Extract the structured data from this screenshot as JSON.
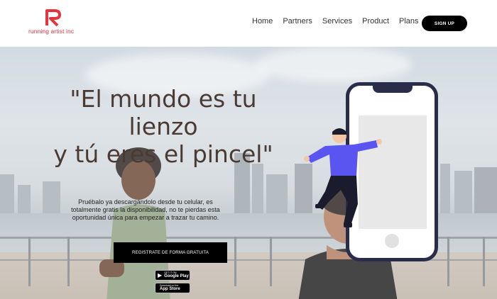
{
  "brand": {
    "name": "running artist inc",
    "logo_letter": "R",
    "color": "#e5343b"
  },
  "nav": {
    "items": [
      "Home",
      "Partners",
      "Services",
      "Product",
      "Plans"
    ],
    "signup_label": "SIGN UP"
  },
  "hero": {
    "headline": [
      "\"El mundo es tu",
      "lienzo",
      "y tú eres el pincel\""
    ],
    "subtext": "Pruébalo ya descargándolo desde tu celular, es totalmente gratis la disponibilidad, no te pierdas esta oportunidad única para empezar a trazar tu camino.",
    "cta_label": "REGISTRATE DE FORMA GRATUITA",
    "stores": [
      {
        "small": "GET IT ON",
        "big": "Google Play",
        "icon": "google-play-icon"
      },
      {
        "small": "Download on the",
        "big": "App Store",
        "icon": "apple-icon"
      }
    ]
  },
  "colors": {
    "headline": "#4a3a32",
    "phone_frame": "#2a2d4a",
    "figure_shirt": "#5a55f0"
  }
}
